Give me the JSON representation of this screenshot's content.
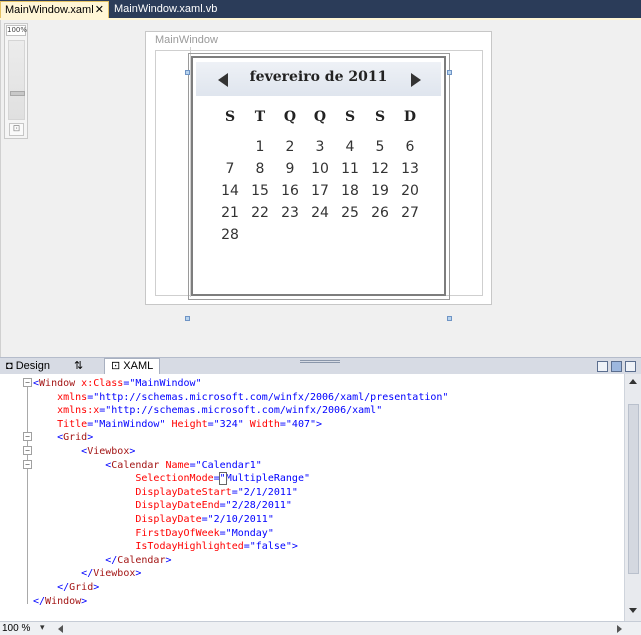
{
  "tabs": [
    {
      "label": "MainWindow.xaml",
      "active": true
    },
    {
      "label": "MainWindow.xaml.vb",
      "active": false
    }
  ],
  "tab_close_glyph": "✕",
  "designer": {
    "zoom_label": "100%",
    "window_title": "MainWindow",
    "calendar": {
      "month_title": "fevereiro de 2011",
      "weekdays": [
        "S",
        "T",
        "Q",
        "Q",
        "S",
        "S",
        "D"
      ],
      "weeks": [
        [
          "",
          "1",
          "2",
          "3",
          "4",
          "5",
          "6"
        ],
        [
          "7",
          "8",
          "9",
          "10",
          "11",
          "12",
          "13"
        ],
        [
          "14",
          "15",
          "16",
          "17",
          "18",
          "19",
          "20"
        ],
        [
          "21",
          "22",
          "23",
          "24",
          "25",
          "26",
          "27"
        ],
        [
          "28",
          "",
          "",
          "",
          "",
          "",
          ""
        ]
      ]
    }
  },
  "view_tabs": {
    "design": "Design",
    "swap_glyph": "⇅",
    "xaml": "XAML"
  },
  "code_lines": [
    [
      {
        "c": "t-blue",
        "t": "<"
      },
      {
        "c": "t-tag",
        "t": "Window"
      },
      {
        "c": "t-attr",
        "t": " x:Class"
      },
      {
        "c": "t-blue",
        "t": "=\"MainWindow\""
      }
    ],
    [
      {
        "c": "",
        "t": "    "
      },
      {
        "c": "t-attr",
        "t": "xmlns"
      },
      {
        "c": "t-blue",
        "t": "=\"http://schemas.microsoft.com/winfx/2006/xaml/presentation\""
      }
    ],
    [
      {
        "c": "",
        "t": "    "
      },
      {
        "c": "t-attr",
        "t": "xmlns:x"
      },
      {
        "c": "t-blue",
        "t": "=\"http://schemas.microsoft.com/winfx/2006/xaml\""
      }
    ],
    [
      {
        "c": "",
        "t": "    "
      },
      {
        "c": "t-attr",
        "t": "Title"
      },
      {
        "c": "t-blue",
        "t": "=\"MainWindow\""
      },
      {
        "c": "t-attr",
        "t": " Height"
      },
      {
        "c": "t-blue",
        "t": "=\"324\""
      },
      {
        "c": "t-attr",
        "t": " Width"
      },
      {
        "c": "t-blue",
        "t": "=\"407\">"
      }
    ],
    [
      {
        "c": "",
        "t": "    "
      },
      {
        "c": "t-blue",
        "t": "<"
      },
      {
        "c": "t-tag",
        "t": "Grid"
      },
      {
        "c": "t-blue",
        "t": ">"
      }
    ],
    [
      {
        "c": "",
        "t": "        "
      },
      {
        "c": "t-blue",
        "t": "<"
      },
      {
        "c": "t-tag",
        "t": "Viewbox"
      },
      {
        "c": "t-blue",
        "t": ">"
      }
    ],
    [
      {
        "c": "",
        "t": "            "
      },
      {
        "c": "t-blue",
        "t": "<"
      },
      {
        "c": "t-tag",
        "t": "Calendar"
      },
      {
        "c": "t-attr",
        "t": " Name"
      },
      {
        "c": "t-blue",
        "t": "=\"Calendar1\""
      }
    ],
    [
      {
        "c": "",
        "t": "                 "
      },
      {
        "c": "t-attr",
        "t": "SelectionMode"
      },
      {
        "c": "t-blue",
        "t": "="
      },
      {
        "c": "t-blue t-cur",
        "t": "\""
      },
      {
        "c": "t-blue",
        "t": "MultipleRange\""
      }
    ],
    [
      {
        "c": "",
        "t": "                 "
      },
      {
        "c": "t-attr",
        "t": "DisplayDateStart"
      },
      {
        "c": "t-blue",
        "t": "=\"2/1/2011\""
      }
    ],
    [
      {
        "c": "",
        "t": "                 "
      },
      {
        "c": "t-attr",
        "t": "DisplayDateEnd"
      },
      {
        "c": "t-blue",
        "t": "=\"2/28/2011\""
      }
    ],
    [
      {
        "c": "",
        "t": "                 "
      },
      {
        "c": "t-attr",
        "t": "DisplayDate"
      },
      {
        "c": "t-blue",
        "t": "=\"2/10/2011\""
      }
    ],
    [
      {
        "c": "",
        "t": "                 "
      },
      {
        "c": "t-attr",
        "t": "FirstDayOfWeek"
      },
      {
        "c": "t-blue",
        "t": "=\"Monday\""
      }
    ],
    [
      {
        "c": "",
        "t": "                 "
      },
      {
        "c": "t-attr",
        "t": "IsTodayHighlighted"
      },
      {
        "c": "t-blue",
        "t": "=\"false\">"
      }
    ],
    [
      {
        "c": "",
        "t": "            "
      },
      {
        "c": "t-blue",
        "t": "</"
      },
      {
        "c": "t-tag",
        "t": "Calendar"
      },
      {
        "c": "t-blue",
        "t": ">"
      }
    ],
    [
      {
        "c": "",
        "t": "        "
      },
      {
        "c": "t-blue",
        "t": "</"
      },
      {
        "c": "t-tag",
        "t": "Viewbox"
      },
      {
        "c": "t-blue",
        "t": ">"
      }
    ],
    [
      {
        "c": "",
        "t": "    "
      },
      {
        "c": "t-blue",
        "t": "</"
      },
      {
        "c": "t-tag",
        "t": "Grid"
      },
      {
        "c": "t-blue",
        "t": ">"
      }
    ],
    [
      {
        "c": "t-blue",
        "t": "</"
      },
      {
        "c": "t-tag",
        "t": "Window"
      },
      {
        "c": "t-blue",
        "t": ">"
      }
    ]
  ],
  "fold_markers": [
    "−",
    "−",
    "−",
    "−"
  ],
  "status": {
    "zoom": "100 %",
    "zoom_dropdown_glyph": "▾"
  },
  "colors": {
    "tab_bar": "#2b3c59",
    "active_tab": "#fff6d6",
    "xml_tag": "#a31515",
    "xml_attr": "#ff0000",
    "xml_punct": "#0000ff"
  }
}
